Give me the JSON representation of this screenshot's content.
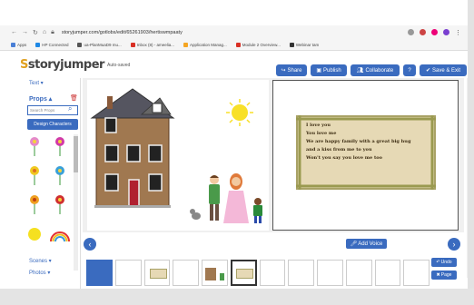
{
  "browser": {
    "url": "storyjumper.com/gotlobs/edit/65261903/hertiswmpaaty",
    "bookmarks": [
      {
        "label": "Apps",
        "color": "#4a7fd6"
      },
      {
        "label": "HP Connected",
        "color": "#1e88e5"
      },
      {
        "label": "ua-PlanMuaD9 mu...",
        "color": "#555555"
      },
      {
        "label": "Inbox (8) - ameelia...",
        "color": "#d93025"
      },
      {
        "label": "Application Manag...",
        "color": "#f5a623"
      },
      {
        "label": "Module 2 Overview...",
        "color": "#d93025"
      },
      {
        "label": "Webinar tam",
        "color": "#333333"
      }
    ]
  },
  "app": {
    "logo_prefix": "story",
    "logo_suffix": "jumper",
    "autosave": "Auto-saved",
    "buttons": {
      "share": "Share",
      "publish": "Publish",
      "collaborate": "Collaborate",
      "help": "?",
      "save_exit": "Save & Exit"
    }
  },
  "left_panel": {
    "text_label": "Text ▾",
    "props_label": "Props ▴",
    "search_placeholder": "Search Props",
    "design_button": "Design Characters",
    "scenes_label": "Scenes ▾",
    "photos_label": "Photos ▾"
  },
  "page": {
    "story_lines": [
      "I love you",
      "You love me",
      "We are happy family with a great big hug",
      "and  a kiss from me to you",
      "Won't you say you love me too"
    ]
  },
  "toolbar": {
    "add_voice": "Add Voice",
    "undo": "Undo",
    "page": "Page"
  },
  "colors": {
    "accent": "#3a6bbf",
    "textbox_bg": "#e6d9b5",
    "textbox_border": "#a9a266"
  }
}
